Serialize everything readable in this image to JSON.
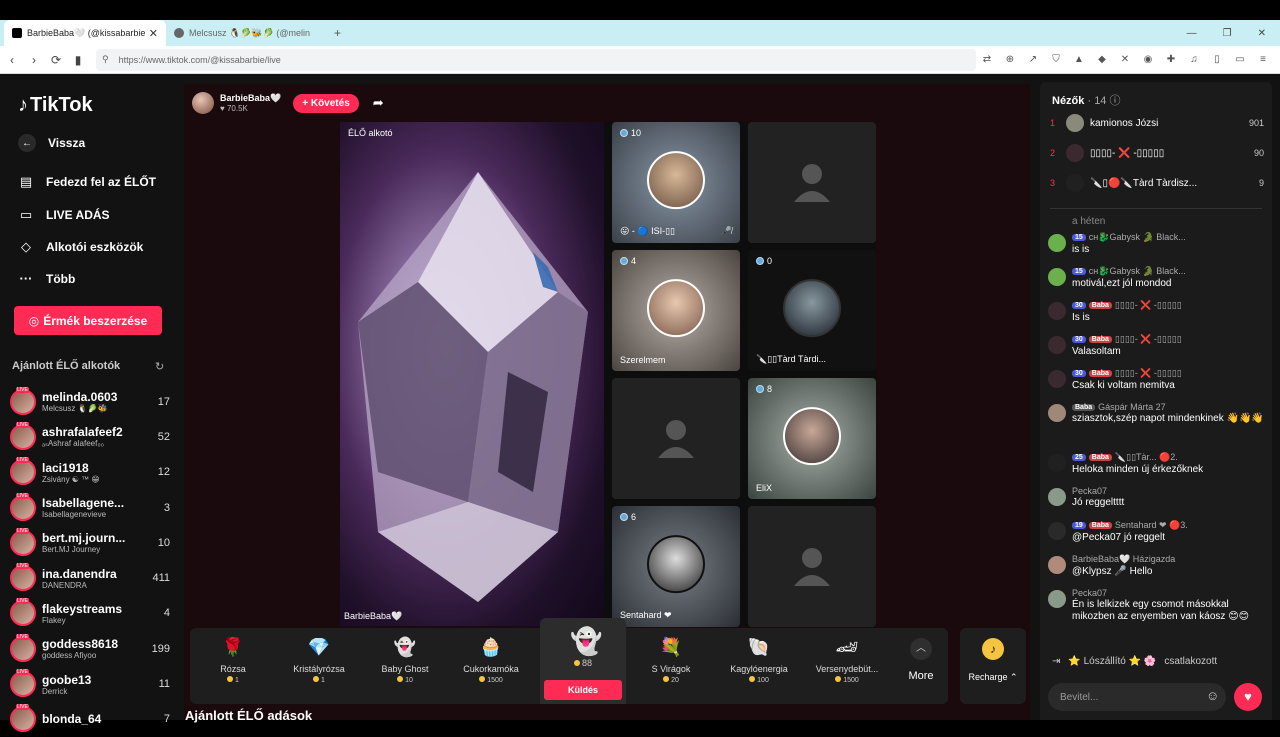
{
  "browser": {
    "tabs": [
      {
        "title": "BarbieBaba🤍 (@kissabarbie",
        "active": true
      },
      {
        "title": "Melcsusz 🐧🥬🐝🥬 (@melin",
        "active": false
      }
    ],
    "new_tab_icon": "+",
    "url": "https://www.tiktok.com/@kissabarbie/live"
  },
  "sidebar": {
    "logo": "TikTok",
    "back_label": "Vissza",
    "nav": [
      {
        "label": "Fedezd fel az ÉLŐT",
        "icon": "explore-icon"
      },
      {
        "label": "LIVE ADÁS",
        "icon": "live-camera-icon"
      },
      {
        "label": "Alkotói eszközök",
        "icon": "creator-tools-icon"
      },
      {
        "label": "Több",
        "icon": "more-dots-icon"
      }
    ],
    "coins_button": "Érmék beszerzése",
    "recommended_title": "Ajánlott ÉLŐ alkotók",
    "recommended": [
      {
        "name": "melinda.0603",
        "sub": "Melcsusz 🐧🥬🐝",
        "count": "17"
      },
      {
        "name": "ashrafalafeef2",
        "sub": "ₐₛAshraf alafeef₀₀",
        "count": "52"
      },
      {
        "name": "laci1918",
        "sub": "Zsivány ☯ ™ 😁",
        "count": "12"
      },
      {
        "name": "Isabellagene...",
        "sub": "Isabellagenevieve",
        "count": "3"
      },
      {
        "name": "bert.mj.journ...",
        "sub": "Bert.MJ Journey",
        "count": "10"
      },
      {
        "name": "ina.danendra",
        "sub": "DANENDRA",
        "count": "411"
      },
      {
        "name": "flakeystreams",
        "sub": "Flakey",
        "count": "4"
      },
      {
        "name": "goddess8618",
        "sub": "goddess Afiyoo",
        "count": "199"
      },
      {
        "name": "goobe13",
        "sub": "Derrick",
        "count": "11"
      },
      {
        "name": "blonda_64",
        "sub": "",
        "count": "7"
      }
    ],
    "live_badge": "LIVE"
  },
  "host": {
    "name": "BarbieBaba🤍",
    "likes": "♥ 70.5K",
    "follow": "+ Követés"
  },
  "stage": {
    "main_label": "ÉLŐ alkotó",
    "main_host": "BarbieBaba🤍",
    "guests": [
      {
        "count": "10",
        "name": "😛 - 🔵 ISI-▯▯",
        "muted": true
      },
      {
        "count": "",
        "name": "",
        "empty": true
      },
      {
        "count": "4",
        "name": "Szerelmem"
      },
      {
        "count": "0",
        "name": "🔪▯▯Tàrd Tàrdi..."
      },
      {
        "count": "",
        "name": "",
        "empty": true
      },
      {
        "count": "8",
        "name": "EliX"
      },
      {
        "count": "6",
        "name": "Sentahard ❤"
      },
      {
        "count": "",
        "name": "",
        "empty": true
      }
    ]
  },
  "gifts": [
    {
      "name": "Rózsa",
      "price": "1",
      "icon": "🌹"
    },
    {
      "name": "Kristályrózsa",
      "price": "1",
      "icon": "💎"
    },
    {
      "name": "Baby Ghost",
      "price": "10",
      "icon": "👻"
    },
    {
      "name": "Cukorkamóka",
      "price": "1500",
      "icon": "🧁"
    },
    {
      "name": "",
      "price": "88",
      "icon": "👻",
      "selected": true
    },
    {
      "name": "S Virágok",
      "price": "20",
      "icon": "💐"
    },
    {
      "name": "Kagylóenergia",
      "price": "100",
      "icon": "🐚"
    },
    {
      "name": "Versenydebüt...",
      "price": "1500",
      "icon": "🏎"
    }
  ],
  "send_label": "Küldés",
  "more_label": "More",
  "recharge_label": "Recharge",
  "recommended_lives_title": "Ajánlott ÉLŐ adások",
  "chat": {
    "viewers_title": "Nézők",
    "viewers_count": "· 14",
    "top": [
      {
        "rank": "1",
        "name": "kamionos Józsi",
        "value": "901"
      },
      {
        "rank": "2",
        "name": "▯▯▯▯- ❌ -▯▯▯▯▯",
        "value": "90"
      },
      {
        "rank": "3",
        "name": "🔪▯🔴🔪Tàrd Tàrdisz...",
        "value": "9"
      }
    ],
    "week_label": "a héten",
    "messages": [
      {
        "level": "15",
        "fan": "",
        "user": "ᴄʜ🐉Gabysk 🐊 Black...",
        "text": "is is"
      },
      {
        "level": "15",
        "fan": "",
        "user": "ᴄʜ🐉Gabysk 🐊 Black...",
        "text": "motivál,ezt jól mondod"
      },
      {
        "level": "30",
        "fan": "Baba",
        "user": "▯▯▯▯- ❌ -▯▯▯▯▯",
        "text": "Is is"
      },
      {
        "level": "30",
        "fan": "Baba",
        "user": "▯▯▯▯- ❌ -▯▯▯▯▯",
        "text": "Valasoltam"
      },
      {
        "level": "30",
        "fan": "Baba",
        "user": "▯▯▯▯- ❌ -▯▯▯▯▯",
        "text": "Csak ki voltam nemitva"
      },
      {
        "level": "",
        "fan": "Baba",
        "user": "Gáspár Márta 27",
        "text": "sziasztok,szép napot mindenkinek 👋👋👋"
      },
      {
        "level": "25",
        "fan": "Baba",
        "user": "🔪▯▯Tàr... 🔴2.",
        "text": "Heloka minden új érkezőknek"
      },
      {
        "level": "",
        "fan": "",
        "user": "Pecka07",
        "text": "Jó reggeltttt"
      },
      {
        "level": "19",
        "fan": "Baba",
        "user": "Sentahard ❤ 🔴3.",
        "text": "@Pecka07 jó reggelt"
      },
      {
        "level": "",
        "fan": "",
        "user": "BarbieBaba🤍 Házigazda",
        "text": "@Klypsz 🎤 Hello"
      },
      {
        "level": "",
        "fan": "",
        "user": "Pecka07",
        "text": "Én is lelkizek egy csomot másokkal mikozben az enyemben van káosz 😊😊"
      }
    ],
    "joined_text": "⭐ Lószállító ⭐ 🌸",
    "joined_action": "csatlakozott",
    "input_placeholder": "Bevitel..."
  }
}
